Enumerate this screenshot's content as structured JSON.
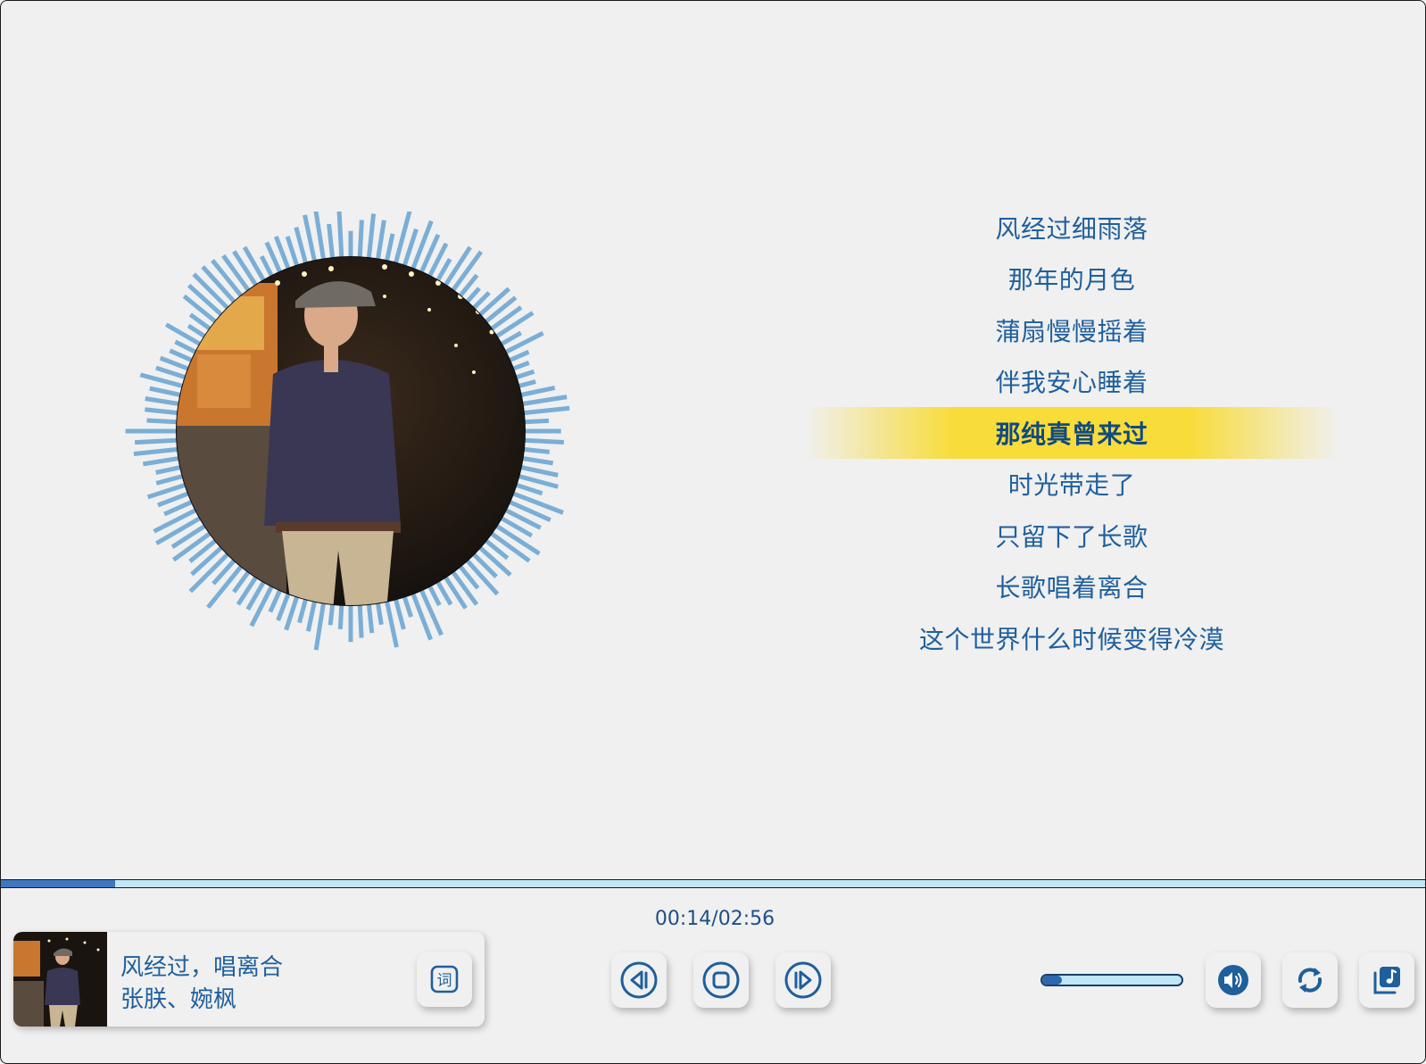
{
  "lyrics": {
    "lines": [
      "风经过细雨落",
      "那年的月色",
      "蒲扇慢慢摇着",
      "伴我安心睡着",
      "那纯真曾来过",
      "时光带走了",
      "只留下了长歌",
      "长歌唱着离合",
      "这个世界什么时候变得冷漠"
    ],
    "active_index": 4
  },
  "playback": {
    "time": "00:14/02:56",
    "progress": 0.08
  },
  "now_playing": {
    "title": "风经过，唱离合",
    "artist": "张朕、婉枫"
  },
  "controls": {
    "lyrics_button": "词",
    "volume_level": 0.14
  },
  "icons": {
    "lyrics": "lyrics-icon",
    "previous": "previous-icon",
    "stop": "stop-icon",
    "next": "next-icon",
    "volume": "speaker-icon",
    "loop": "repeat-icon",
    "playlist": "playlist-icon"
  },
  "colors": {
    "accent": "#1f5f9c",
    "highlight": "#f8dc3a",
    "visualizer": "#7aaed6",
    "progress": "#3f76c0",
    "track": "#bfe7f5"
  }
}
